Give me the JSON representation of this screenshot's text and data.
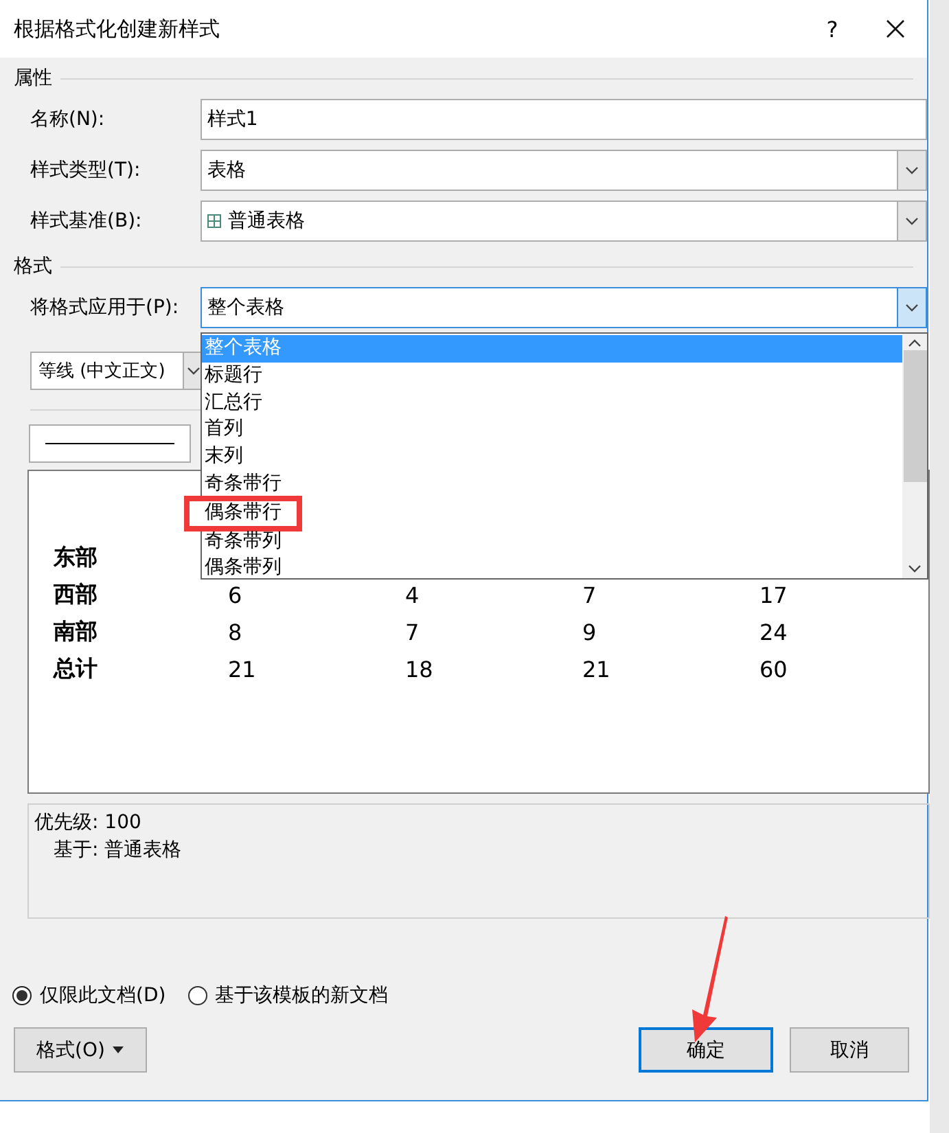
{
  "window": {
    "title": "根据格式化创建新样式",
    "help": "?"
  },
  "properties": {
    "heading": "属性",
    "fields": [
      {
        "kind": "text",
        "label": "名称(N):",
        "value": "样式1"
      },
      {
        "kind": "combo",
        "label": "样式类型(T):",
        "value": "表格"
      },
      {
        "kind": "table-combo",
        "label": "样式基准(B):",
        "value": "普通表格"
      }
    ]
  },
  "format": {
    "heading": "格式",
    "apply_label": "将格式应用于(P):",
    "apply_value": "整个表格",
    "font": "等线 (中文正文)",
    "options": [
      {
        "label": "整个表格",
        "selected": true,
        "annotated": false
      },
      {
        "label": "标题行",
        "selected": false,
        "annotated": false
      },
      {
        "label": "汇总行",
        "selected": false,
        "annotated": false
      },
      {
        "label": "首列",
        "selected": false,
        "annotated": false
      },
      {
        "label": "末列",
        "selected": false,
        "annotated": false
      },
      {
        "label": "奇条带行",
        "selected": false,
        "annotated": false
      },
      {
        "label": "偶条带行",
        "selected": false,
        "annotated": true
      },
      {
        "label": "奇条带列",
        "selected": false,
        "annotated": false
      },
      {
        "label": "偶条带列",
        "selected": false,
        "annotated": false
      }
    ]
  },
  "preview": {
    "rows": [
      {
        "label": "东部",
        "cells": []
      },
      {
        "label": "西部",
        "cells": [
          "6",
          "4",
          "7",
          "17"
        ]
      },
      {
        "label": "南部",
        "cells": [
          "8",
          "7",
          "9",
          "24"
        ]
      },
      {
        "label": "总计",
        "cells": [
          "21",
          "18",
          "21",
          "60"
        ]
      }
    ]
  },
  "description": {
    "priority": "优先级: 100",
    "based_on": "基于: 普通表格"
  },
  "scope": [
    {
      "label": "仅限此文档(D)",
      "selected": true
    },
    {
      "label": "基于该模板的新文档",
      "selected": false
    }
  ],
  "format_button": "格式(O)",
  "buttons": [
    {
      "label": "确定",
      "default": true
    },
    {
      "label": "取消",
      "default": false
    }
  ]
}
